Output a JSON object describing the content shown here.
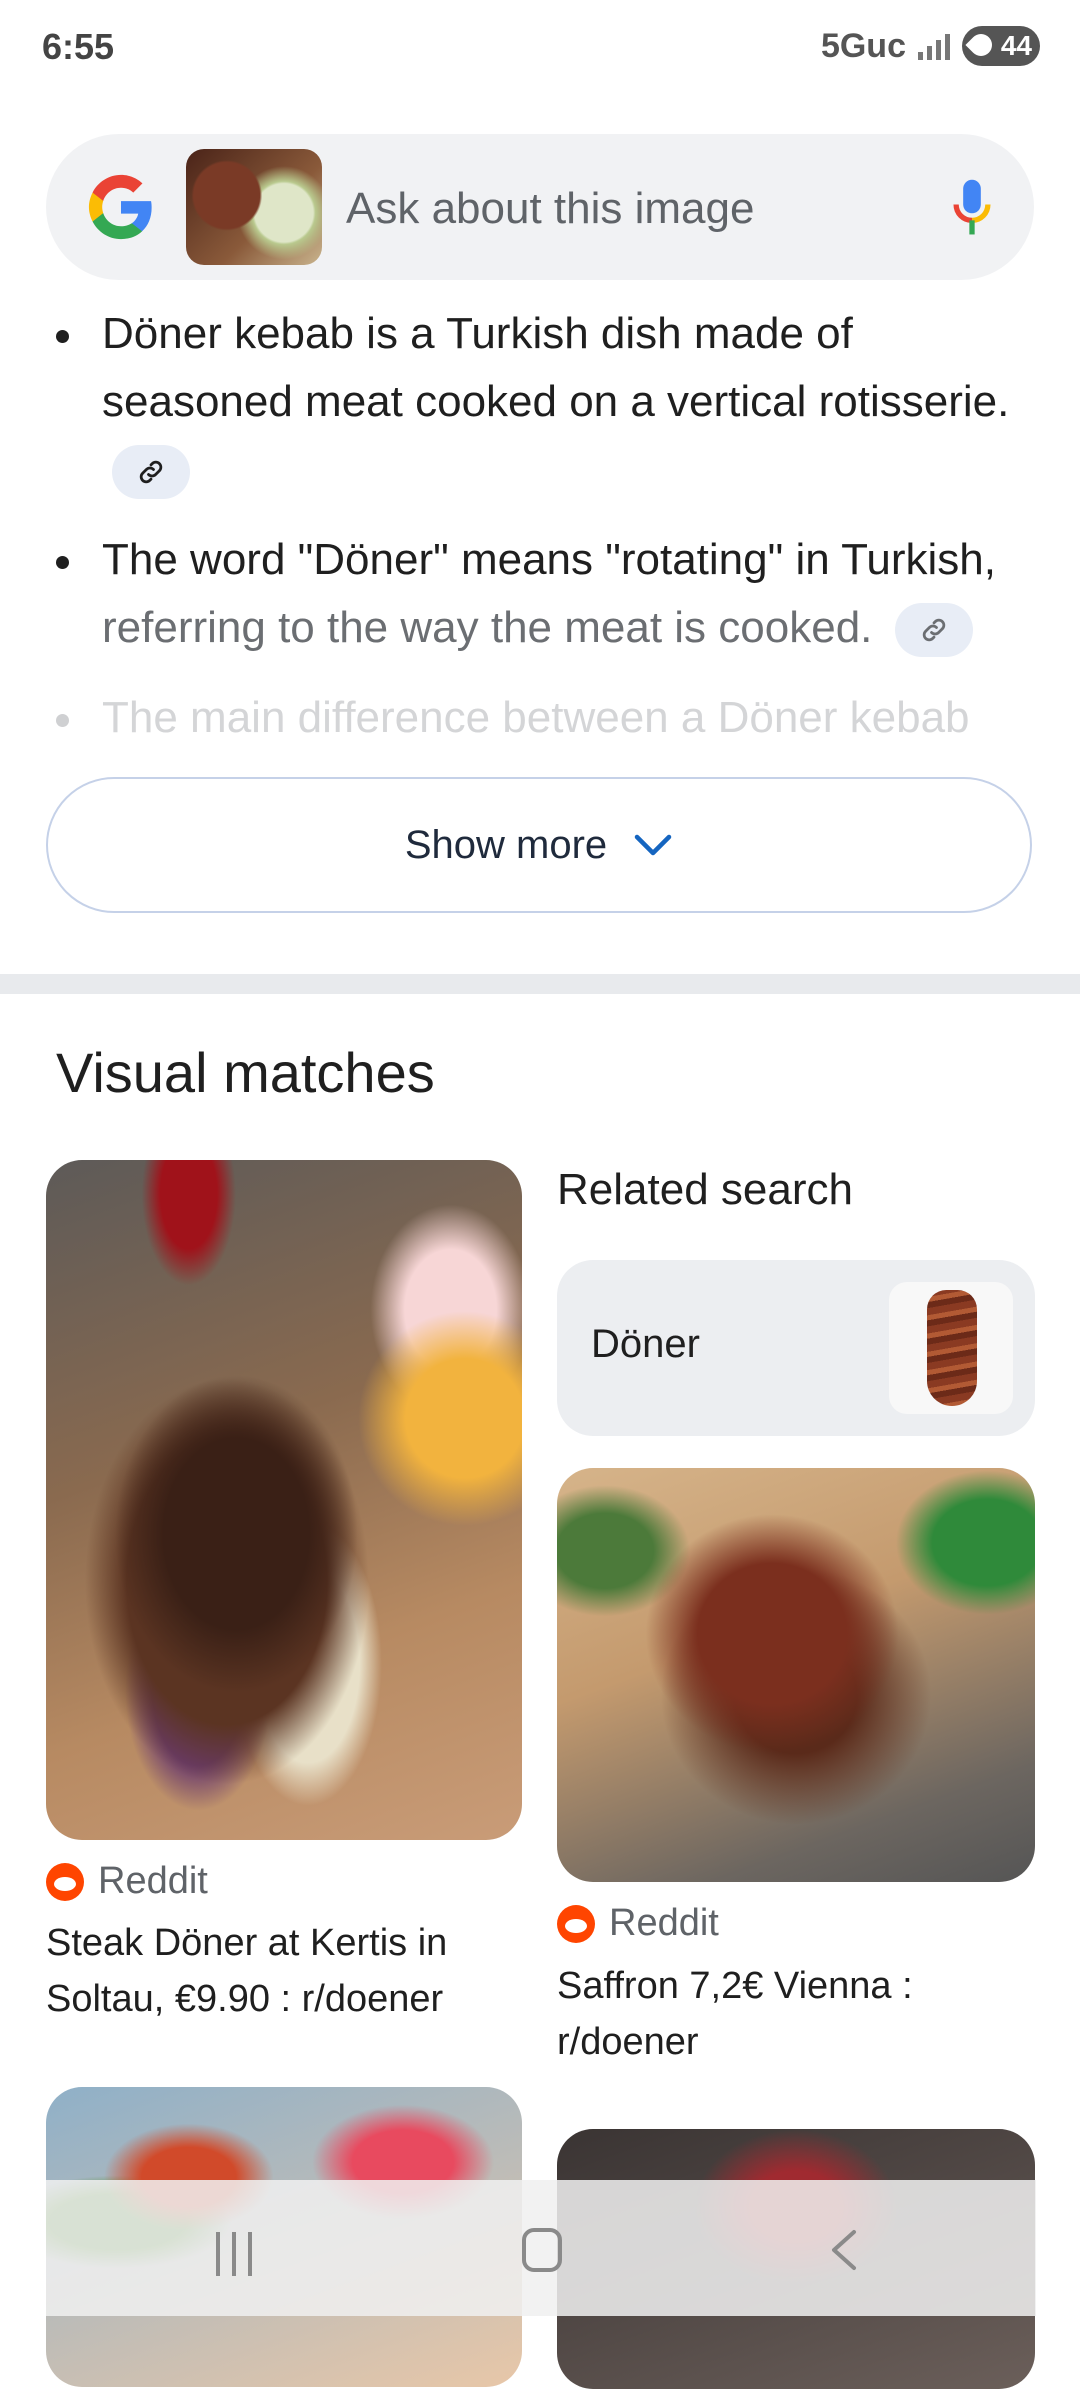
{
  "status": {
    "time": "6:55",
    "network": "5Guc",
    "battery": "44"
  },
  "search": {
    "placeholder": "Ask about this image",
    "logo_icon": "google-g-logo",
    "mic_icon": "microphone-icon"
  },
  "overview": {
    "bullets": [
      "Döner kebab is a Turkish dish made of seasoned meat cooked on a vertical rotisserie.",
      "The word \"Döner\" means \"rotating\" in Turkish,",
      "referring to the way the meat is cooked.",
      "The main difference between a Döner kebab"
    ],
    "show_more": "Show more"
  },
  "visual_matches": {
    "title": "Visual matches",
    "related_title": "Related search",
    "related_chip": "Döner",
    "cards": [
      {
        "source": "Reddit",
        "caption": "Steak Döner at Kertis in Soltau, €9.90 : r/doener"
      },
      {
        "source": "Reddit",
        "caption": "Saffron 7,2€ Vienna : r/doener"
      }
    ]
  },
  "colors": {
    "accent_blue": "#1a73e8",
    "reddit": "#ff4500",
    "chip_bg": "#e8edf6"
  }
}
